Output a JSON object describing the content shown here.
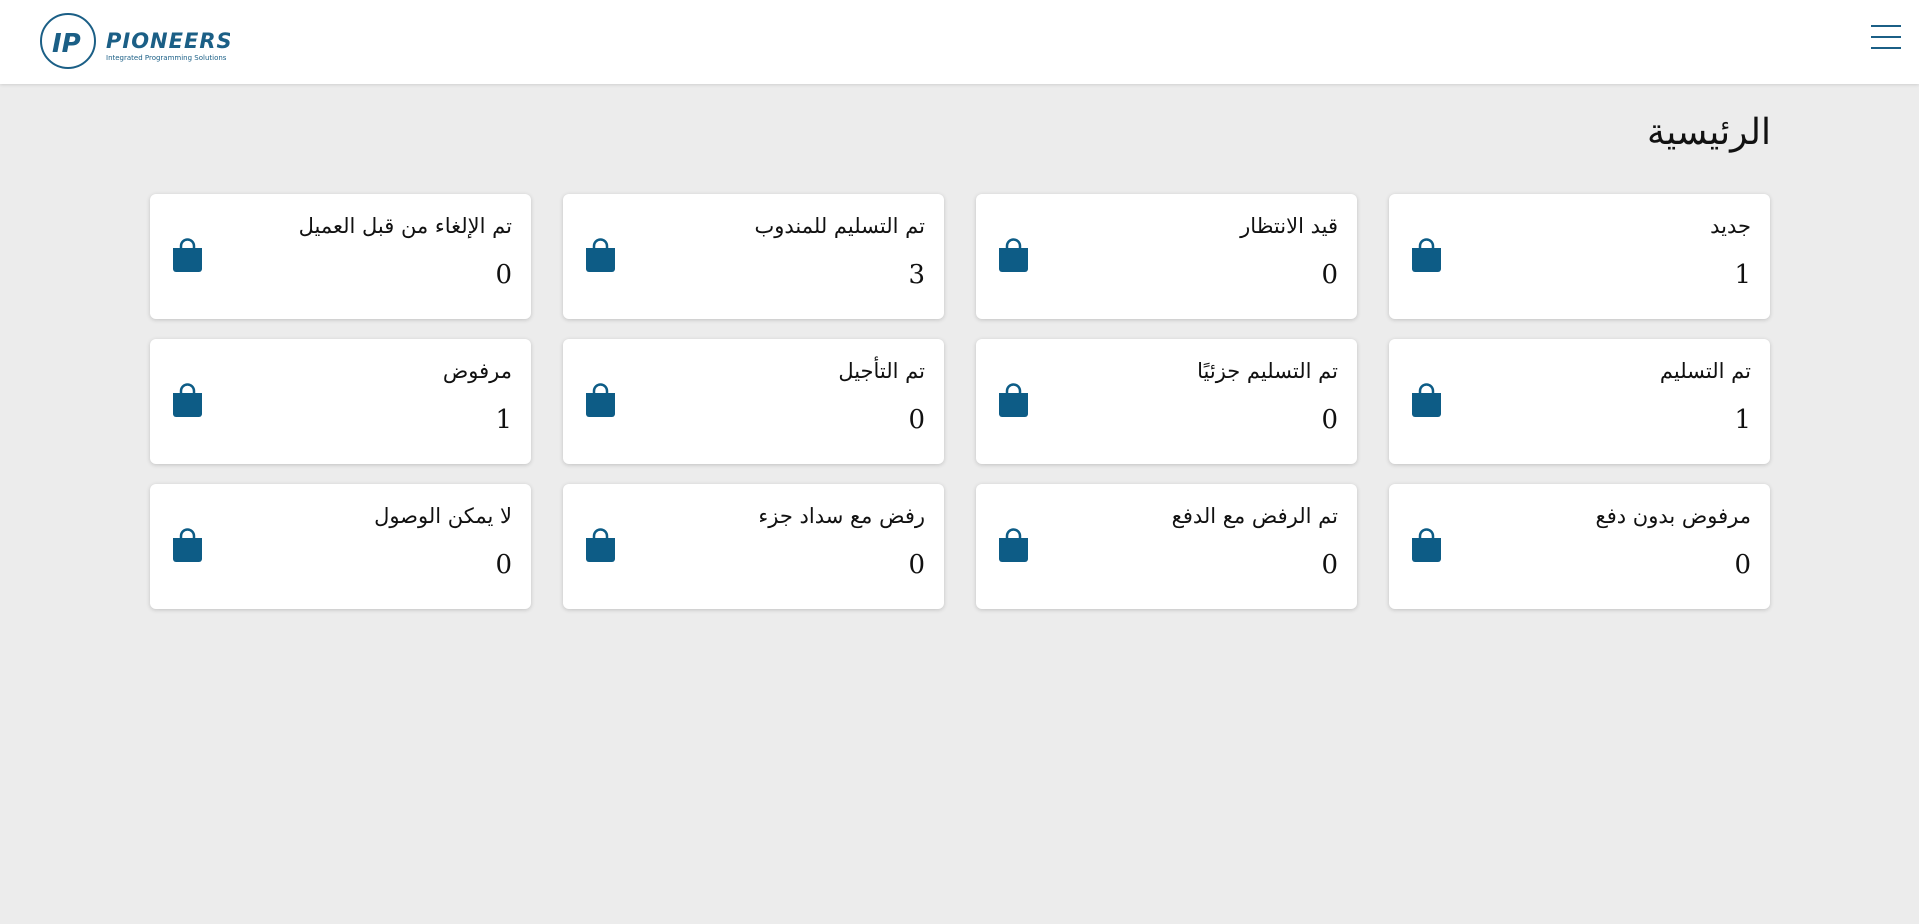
{
  "header": {
    "brand_name": "PIONEERS",
    "brand_tagline": "Integrated Programming Solutions",
    "logo_mark": "IP",
    "brand_color": "#1b5f86"
  },
  "page": {
    "title": "الرئيسية"
  },
  "colors": {
    "accent": "#0d5c86",
    "background": "#ececec",
    "card": "#ffffff"
  },
  "cards": [
    {
      "label": "جديد",
      "count": "1",
      "icon": "shopping-bag-icon"
    },
    {
      "label": "قيد الانتظار",
      "count": "0",
      "icon": "shopping-bag-icon"
    },
    {
      "label": "تم التسليم للمندوب",
      "count": "3",
      "icon": "shopping-bag-icon"
    },
    {
      "label": "تم الإلغاء من قبل العميل",
      "count": "0",
      "icon": "shopping-bag-icon"
    },
    {
      "label": "تم التسليم",
      "count": "1",
      "icon": "shopping-bag-icon"
    },
    {
      "label": "تم التسليم جزئيًا",
      "count": "0",
      "icon": "shopping-bag-icon"
    },
    {
      "label": "تم التأجيل",
      "count": "0",
      "icon": "shopping-bag-icon"
    },
    {
      "label": "مرفوض",
      "count": "1",
      "icon": "shopping-bag-icon"
    },
    {
      "label": "مرفوض بدون دفع",
      "count": "0",
      "icon": "shopping-bag-icon"
    },
    {
      "label": "تم الرفض مع الدفع",
      "count": "0",
      "icon": "shopping-bag-icon"
    },
    {
      "label": "رفض مع سداد جزء",
      "count": "0",
      "icon": "shopping-bag-icon"
    },
    {
      "label": "لا يمكن الوصول",
      "count": "0",
      "icon": "shopping-bag-icon"
    }
  ]
}
